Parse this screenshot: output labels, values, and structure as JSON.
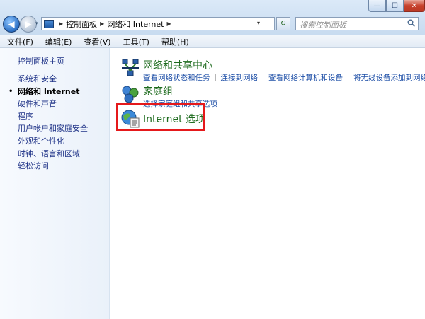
{
  "titlebar": {
    "minimize_glyph": "—",
    "maximize_glyph": "☐",
    "close_glyph": "✕"
  },
  "navbar": {
    "back_glyph": "◀",
    "forward_glyph": "▶",
    "recent_glyph": "▾",
    "address": {
      "separator": "▶",
      "crumbs": [
        "控制面板",
        "网络和 Internet"
      ],
      "dropdown_glyph": "▾"
    },
    "refresh_glyph": "↻",
    "search_placeholder": "搜索控制面板"
  },
  "menubar": {
    "items": [
      "文件(F)",
      "编辑(E)",
      "查看(V)",
      "工具(T)",
      "帮助(H)"
    ]
  },
  "sidebar": {
    "home": "控制面板主页",
    "bullet": "•",
    "items": [
      "系统和安全",
      "网络和 Internet",
      "硬件和声音",
      "程序",
      "用户帐户和家庭安全",
      "外观和个性化",
      "时钟、语言和区域",
      "轻松访问"
    ],
    "current_index": 1
  },
  "categories": [
    {
      "icon": "network-sharing-center-icon",
      "title": "网络和共享中心",
      "links": [
        "查看网络状态和任务",
        "连接到网络",
        "查看网络计算机和设备",
        "将无线设备添加到网络"
      ]
    },
    {
      "icon": "homegroup-icon",
      "title": "家庭组",
      "links": [
        "选择家庭组和共享选项"
      ]
    },
    {
      "icon": "internet-options-icon",
      "title": "Internet 选项",
      "links": []
    }
  ],
  "colors": {
    "link_blue": "#1e4fa7",
    "category_green": "#1e6b1e",
    "highlight_red": "#e5191b"
  }
}
